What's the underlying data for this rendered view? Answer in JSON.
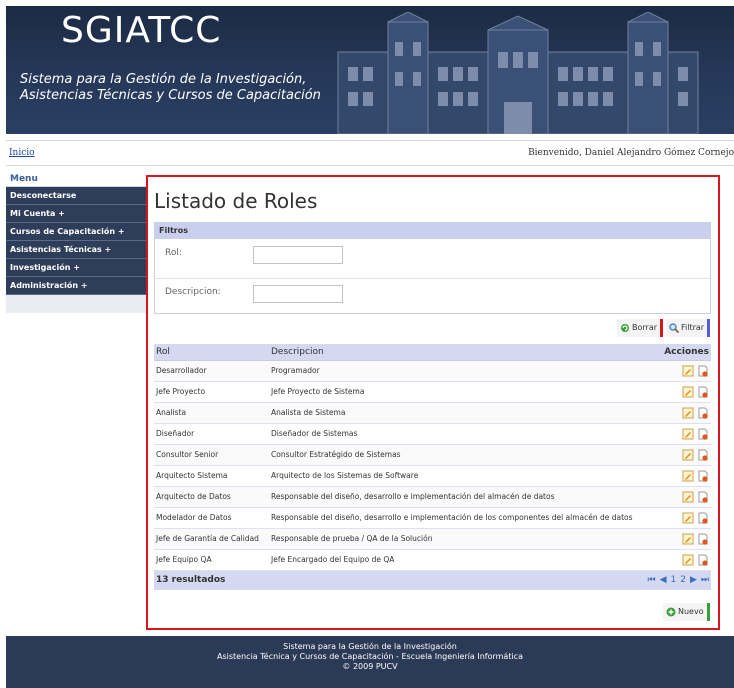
{
  "header": {
    "logo": "SGIATCC",
    "subtitle_line1": "Sistema para la Gestión de la Investigación,",
    "subtitle_line2": "Asistencias Técnicas y Cursos de Capacitación"
  },
  "breadcrumb": {
    "home": "Inicio"
  },
  "welcome": "Bienvenido, Daniel Alejandro Gómez Cornejo",
  "sidebar": {
    "title": "Menu",
    "items": [
      {
        "label": "Desconectarse"
      },
      {
        "label": "Mi Cuenta +"
      },
      {
        "label": "Cursos de Capacitación +"
      },
      {
        "label": "Asistencias Técnicas +"
      },
      {
        "label": "Investigación +"
      },
      {
        "label": "Administración +"
      }
    ]
  },
  "main": {
    "title": "Listado de Roles",
    "filters": {
      "title": "Filtros",
      "rol_label": "Rol:",
      "desc_label": "Descripcion:",
      "rol_value": "",
      "desc_value": ""
    },
    "buttons": {
      "clear": "Borrar",
      "filter": "Filtrar",
      "new": "Nuevo"
    },
    "table": {
      "headers": [
        "Rol",
        "Descripcion",
        "Acciones"
      ],
      "rows": [
        [
          "Desarrollador",
          "Programador"
        ],
        [
          "Jefe Proyecto",
          "Jefe Proyecto de Sistema"
        ],
        [
          "Analista",
          "Analista de Sistema"
        ],
        [
          "Diseñador",
          "Diseñador de Sistemas"
        ],
        [
          "Consultor Senior",
          "Consultor Estratégido de Sistemas"
        ],
        [
          "Arquitecto Sistema",
          "Arquitecto de los Sistemas de Software"
        ],
        [
          "Arquitecto de Datos",
          "Responsable del diseño, desarrollo e implementación del almacén de datos"
        ],
        [
          "Modelador de Datos",
          "Responsable del diseño, desarrollo e implementación de los componentes del almacén de datos"
        ],
        [
          "Jefe de Garantía de Calidad",
          "Responsable de prueba / QA de la Solución"
        ],
        [
          "Jefe Equipo QA",
          "Jefe Encargado del Equipo de QA"
        ]
      ],
      "results": "13 resultados",
      "pages": [
        "1",
        "2"
      ]
    }
  },
  "footer": {
    "line1": "Sistema para la Gestión de la Investigación",
    "line2": "Asistencia Técnica y Cursos de Capacitación - Escuela Ingeniería Informática",
    "line3": "© 2009 PUCV"
  },
  "colors": {
    "header_bg": "#26395a",
    "sidebar_item": "#2d3d5a",
    "highlight_border": "#d9161d",
    "table_head": "#d4d8f0"
  }
}
